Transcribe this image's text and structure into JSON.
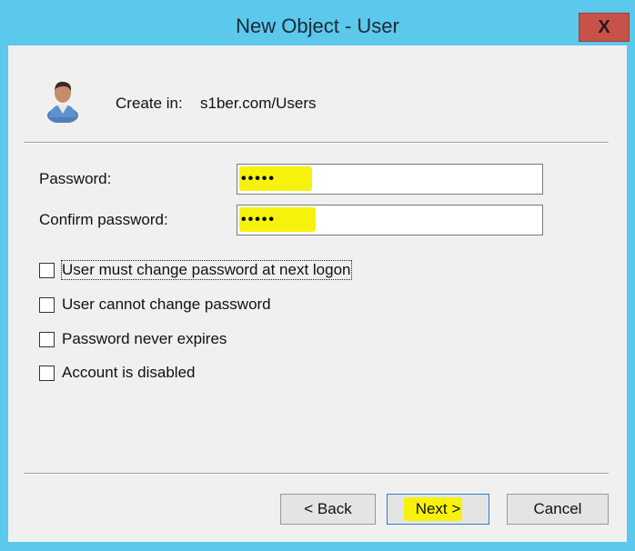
{
  "window": {
    "title": "New Object - User",
    "close_label": "X"
  },
  "header": {
    "create_in_label": "Create in:",
    "create_in_path": "s1ber.com/Users"
  },
  "form": {
    "password_label": "Password:",
    "password_value": "•••••",
    "confirm_label": "Confirm password:",
    "confirm_value": "•••••"
  },
  "options": [
    {
      "label": "User must change password at next logon",
      "checked": false
    },
    {
      "label": "User cannot change password",
      "checked": false
    },
    {
      "label": "Password never expires",
      "checked": false
    },
    {
      "label": "Account is disabled",
      "checked": false
    }
  ],
  "buttons": {
    "back": "< Back",
    "next": "Next >",
    "cancel": "Cancel"
  },
  "colors": {
    "titlebar": "#5bc8ec",
    "close": "#c7524a",
    "highlight": "#f6f20c",
    "dialog_bg": "#f0f0f0"
  }
}
